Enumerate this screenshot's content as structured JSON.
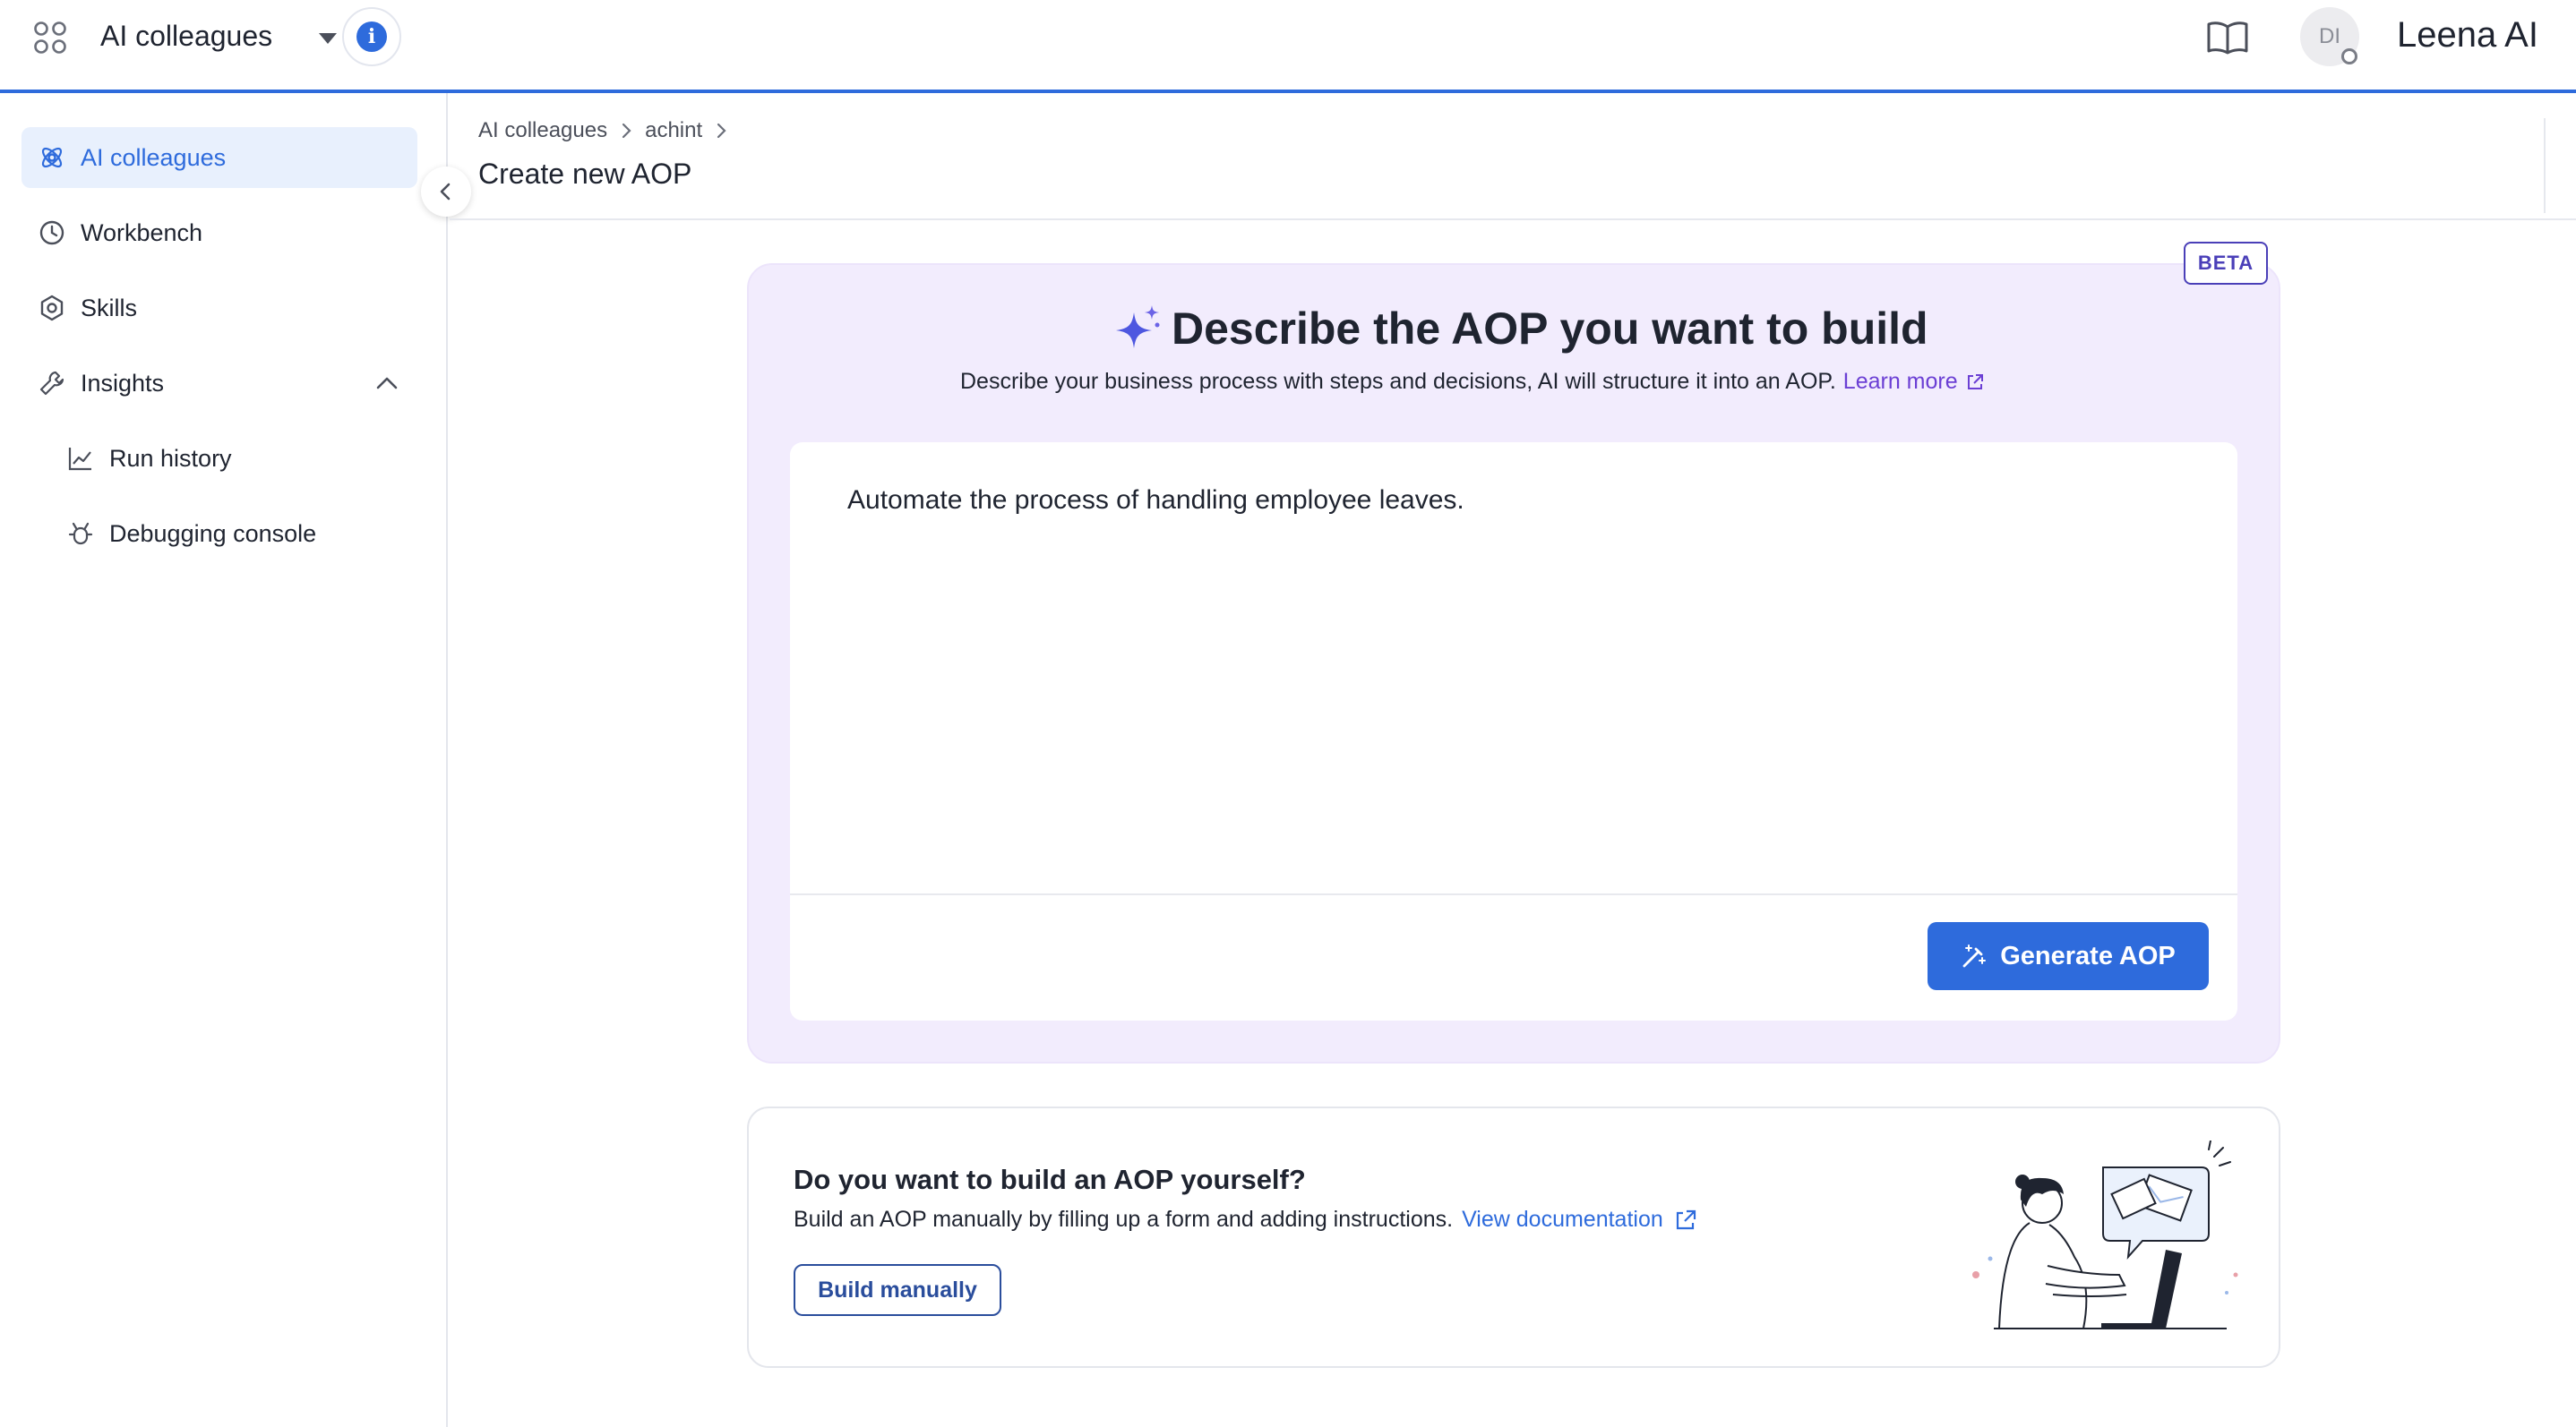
{
  "topbar": {
    "app_title": "AI colleagues",
    "avatar_initials": "DI",
    "logo_text": "Leena AI",
    "icons": [
      "apps-grid-icon",
      "chevron-down-icon",
      "info-icon",
      "book-icon",
      "status-icon"
    ]
  },
  "sidebar": {
    "items": [
      {
        "label": "AI colleagues",
        "icon": "ai-colleagues-icon",
        "active": true
      },
      {
        "label": "Workbench",
        "icon": "clock-icon"
      },
      {
        "label": "Skills",
        "icon": "hexagon-gear-icon"
      },
      {
        "label": "Insights",
        "icon": "wrench-icon"
      },
      {
        "label": "Run history",
        "icon": "trend-chart-icon"
      },
      {
        "label": "Debugging console",
        "icon": "bug-icon"
      }
    ]
  },
  "breadcrumb": [
    "AI colleagues",
    "achint"
  ],
  "page_title": "Create new AOP",
  "ai_card": {
    "badge": "BETA",
    "title": "Describe the AOP you want to build",
    "subtitle": "Describe your business process with steps and decisions, AI will structure it into an AOP.",
    "learn_more": "Learn more",
    "prompt_value": "Automate the process of handling employee leaves.",
    "generate_label": "Generate AOP"
  },
  "manual_card": {
    "title": "Do you want to build an AOP yourself?",
    "subtitle": "Build an AOP manually by filling up a form and adding instructions.",
    "doc_link": "View documentation",
    "build_label": "Build manually"
  },
  "colors": {
    "accent": "#2e6bdc",
    "card_bg": "#f2ecfd",
    "link_purple": "#6b3fd4",
    "beta": "#4a3fb8"
  }
}
